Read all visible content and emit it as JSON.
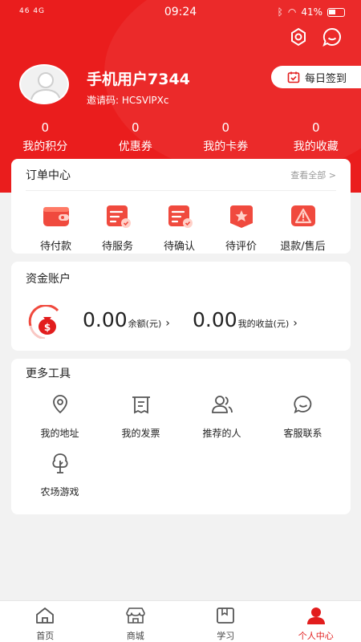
{
  "status_bar": {
    "left": "46 4G",
    "time": "09:24",
    "battery": "41%"
  },
  "profile": {
    "nickname": "手机用户7344",
    "invite_code": "邀请码: HCSVlPXc",
    "signin_label": "每日签到"
  },
  "stats": [
    {
      "value": "0",
      "label": "我的积分"
    },
    {
      "value": "0",
      "label": "优惠券"
    },
    {
      "value": "0",
      "label": "我的卡券"
    },
    {
      "value": "0",
      "label": "我的收藏"
    }
  ],
  "orders": {
    "title": "订单中心",
    "view_all": "查看全部 >",
    "items": [
      {
        "label": "待付款",
        "icon": "wallet-icon"
      },
      {
        "label": "待服务",
        "icon": "service-icon"
      },
      {
        "label": "待确认",
        "icon": "confirm-icon"
      },
      {
        "label": "待评价",
        "icon": "star-icon"
      },
      {
        "label": "退款/售后",
        "icon": "warning-icon"
      }
    ]
  },
  "funds": {
    "title": "资金账户",
    "balance": "0.00",
    "balance_label": "余额(元)",
    "income": "0.00",
    "income_label": "我的收益(元)"
  },
  "tools": {
    "title": "更多工具",
    "items": [
      {
        "label": "我的地址",
        "icon": "location-icon"
      },
      {
        "label": "我的发票",
        "icon": "invoice-icon"
      },
      {
        "label": "推荐的人",
        "icon": "people-icon"
      },
      {
        "label": "客服联系",
        "icon": "chat-icon"
      },
      {
        "label": "农场游戏",
        "icon": "tree-icon"
      }
    ]
  },
  "tabbar": [
    {
      "label": "首页",
      "icon": "home-icon"
    },
    {
      "label": "商城",
      "icon": "shop-icon"
    },
    {
      "label": "学习",
      "icon": "book-icon"
    },
    {
      "label": "个人中心",
      "icon": "user-icon",
      "active": true
    }
  ],
  "colors": {
    "brand_red": "#ea1d1d",
    "card_bg": "#ffffff",
    "page_bg": "#f2f2f2"
  }
}
